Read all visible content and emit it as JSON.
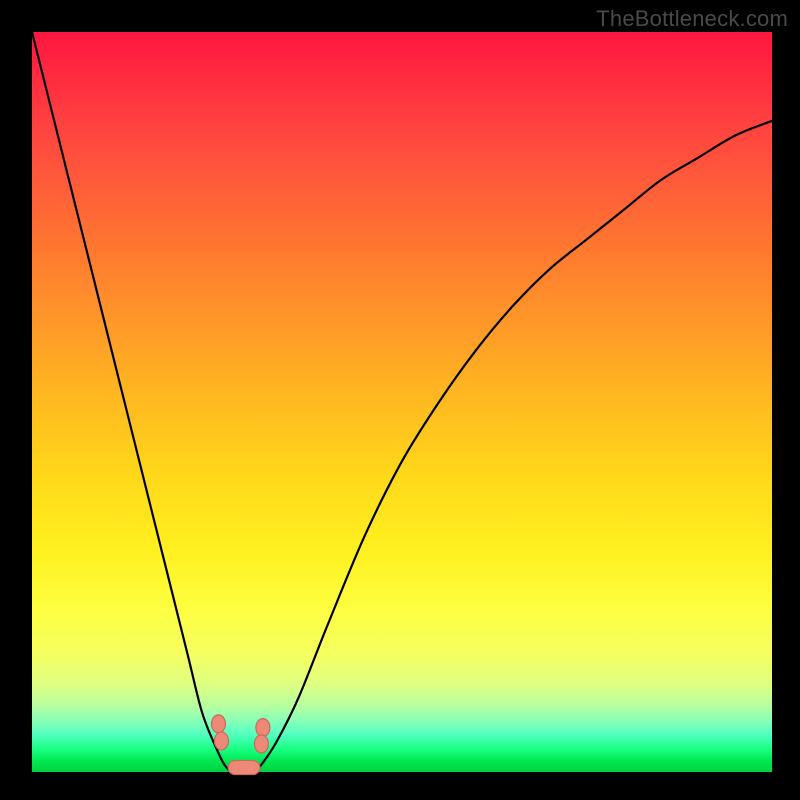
{
  "watermark": "TheBottleneck.com",
  "colors": {
    "frame": "#000000",
    "curve": "#000000",
    "marker_fill": "#ee8877",
    "marker_stroke": "#c96a5a"
  },
  "chart_data": {
    "type": "line",
    "title": "",
    "xlabel": "",
    "ylabel": "",
    "xlim": [
      0,
      100
    ],
    "ylim": [
      0,
      100
    ],
    "grid": false,
    "legend": false,
    "note": "Bottleneck curve: y approximates bottleneck percentage vs component capability; minimum bottleneck near x≈26–30. Values estimated from unlabeled gradient plot.",
    "series": [
      {
        "name": "bottleneck-percent",
        "x": [
          0,
          3,
          6,
          9,
          12,
          15,
          18,
          21,
          23,
          25,
          26,
          27,
          28,
          29,
          30,
          31,
          33,
          36,
          40,
          45,
          50,
          55,
          60,
          65,
          70,
          75,
          80,
          85,
          90,
          95,
          100
        ],
        "y": [
          100,
          88,
          76,
          64,
          52,
          40,
          28,
          16,
          8,
          3,
          1,
          0,
          0,
          0,
          0,
          1,
          4,
          10,
          20,
          32,
          42,
          50,
          57,
          63,
          68,
          72,
          76,
          80,
          83,
          86,
          88
        ]
      }
    ],
    "markers": [
      {
        "name": "left-edge-marker-top",
        "x": 25.2,
        "y": 6.5
      },
      {
        "name": "left-edge-marker-bottom",
        "x": 25.6,
        "y": 4.2
      },
      {
        "name": "right-edge-marker-top",
        "x": 31.2,
        "y": 6.0
      },
      {
        "name": "right-edge-marker-bottom",
        "x": 31.0,
        "y": 3.8
      },
      {
        "name": "valley-bar",
        "x0": 26.5,
        "x1": 30.8,
        "y": 0.6
      }
    ]
  }
}
